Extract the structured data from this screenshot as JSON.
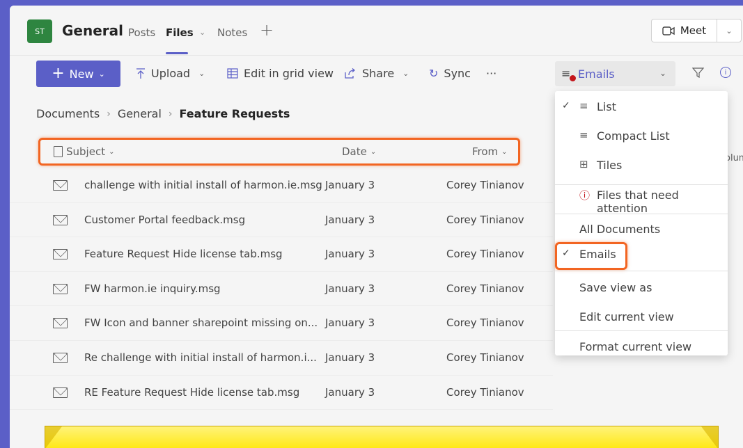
{
  "team": {
    "initials": "ST",
    "name": "General",
    "tabs": [
      "Posts",
      "Files",
      "Notes"
    ],
    "active_tab": "Files",
    "meet_label": "Meet"
  },
  "toolbar": {
    "new_label": "New",
    "upload_label": "Upload",
    "edit_grid_label": "Edit in grid view",
    "share_label": "Share",
    "sync_label": "Sync",
    "more_label": "···",
    "view_label": "Emails"
  },
  "breadcrumb": [
    "Documents",
    "General",
    "Feature Requests"
  ],
  "columns": {
    "subject": "Subject",
    "date": "Date",
    "from": "From",
    "peek": "olum"
  },
  "rows": [
    {
      "name": "challenge with initial install of harmon.ie.msg",
      "date": "January 3",
      "from": "Corey Tinianov"
    },
    {
      "name": "Customer Portal feedback.msg",
      "date": "January 3",
      "from": "Corey Tinianov"
    },
    {
      "name": "Feature Request  Hide license tab.msg",
      "date": "January 3",
      "from": "Corey Tinianov"
    },
    {
      "name": "FW  harmon.ie inquiry.msg",
      "date": "January 3",
      "from": "Corey Tinianov"
    },
    {
      "name": "FW  Icon and banner sharepoint missing on...",
      "date": "January 3",
      "from": "Corey Tinianov"
    },
    {
      "name": "Re  challenge with initial install of harmon.i...",
      "date": "January 3",
      "from": "Corey Tinianov"
    },
    {
      "name": "RE  Feature Request  Hide license tab.msg",
      "date": "January 3",
      "from": "Corey Tinianov"
    }
  ],
  "view_menu": {
    "list": "List",
    "compact_list": "Compact List",
    "tiles": "Tiles",
    "attention": "Files that need attention",
    "all_documents": "All Documents",
    "emails": "Emails",
    "save_view": "Save view as",
    "edit_view": "Edit current view",
    "format_view": "Format current view"
  },
  "icons": {
    "meet": "video-camera-icon",
    "upload": "upload-icon",
    "grid": "grid-icon",
    "share": "share-icon",
    "sync": "sync-icon",
    "filter": "filter-icon",
    "info": "info-icon",
    "mail": "mail-icon",
    "doc": "document-icon"
  },
  "colors": {
    "brand": "#5b5fc7",
    "highlight": "#f26522",
    "team_avatar": "#2e8540",
    "banner": "#ffe600",
    "alert": "#c4161c"
  }
}
